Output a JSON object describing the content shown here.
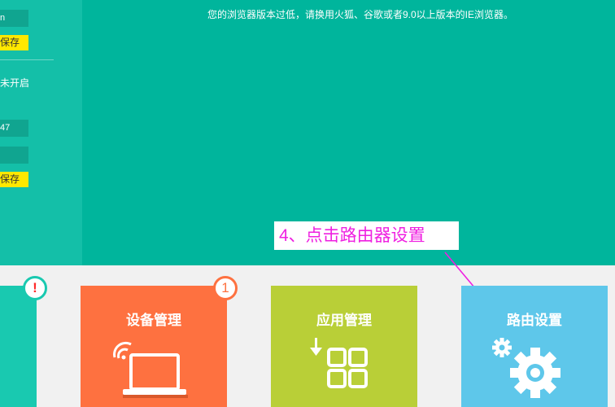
{
  "sidebar": {
    "field1_value": "n",
    "save1_label": "保存",
    "status_text": "未开启",
    "field2_value": "47",
    "field3_value": "",
    "save2_label": "保存"
  },
  "browser_notice": "您的浏览器版本过低，请换用火狐、谷歌或者9.0以上版本的IE浏览器。",
  "annotation": {
    "text": "4、点击路由器设置",
    "color": "#ef1fe1"
  },
  "tiles": {
    "partial": {
      "badge": "!",
      "color": "#19c9b0"
    },
    "device": {
      "title": "设备管理",
      "badge": "1",
      "icon": "laptop-wifi-icon",
      "color": "#fe7140"
    },
    "app": {
      "title": "应用管理",
      "icon": "apps-grid-icon",
      "color": "#b9cf37"
    },
    "route": {
      "title": "路由设置",
      "icon": "gears-icon",
      "color": "#5ec7ea"
    }
  },
  "colors": {
    "main_bg": "#00b59c",
    "sidebar_bg": "#14bfa8",
    "save_button": "#ffe800",
    "page_bg": "#f1f1f1"
  }
}
